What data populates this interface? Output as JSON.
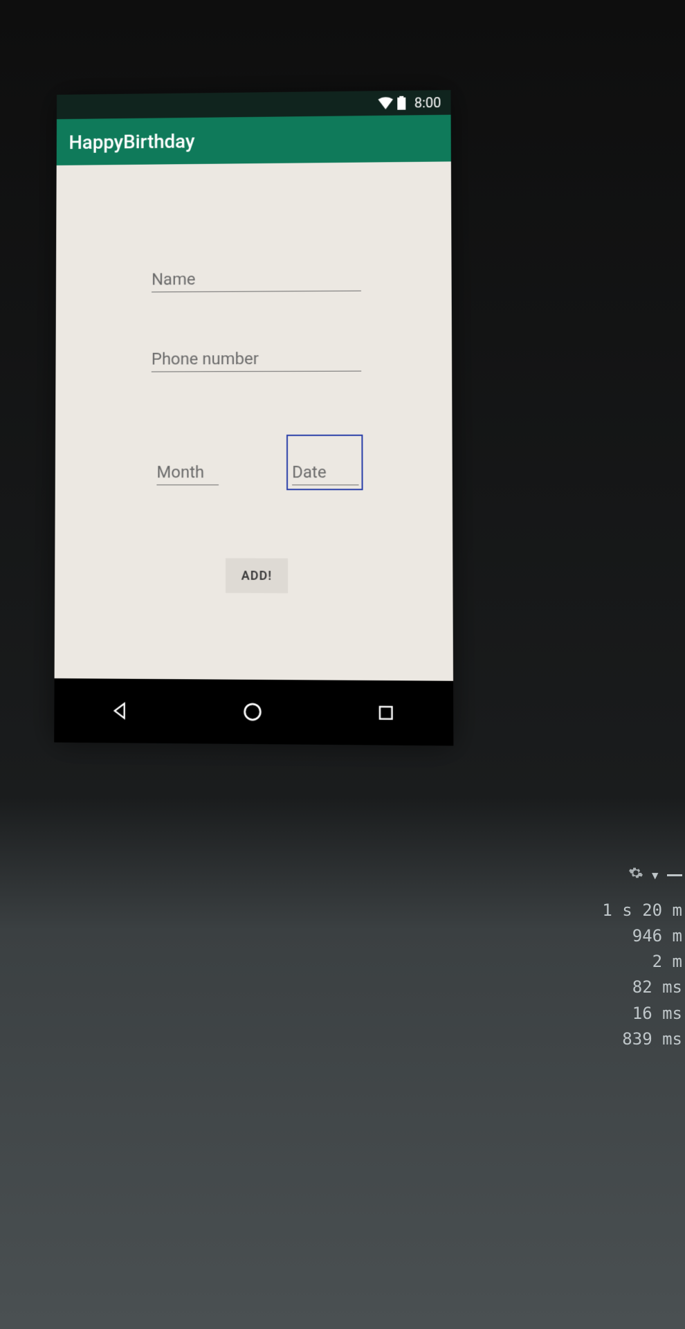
{
  "status": {
    "time": "8:00"
  },
  "appbar": {
    "title": "HappyBirthday"
  },
  "form": {
    "name_hint": "Name",
    "phone_hint": "Phone number",
    "month_hint": "Month",
    "date_hint": "Date",
    "add_label": "ADD!"
  },
  "icons": {
    "wifi": "wifi-icon",
    "battery": "battery-icon",
    "back": "back-icon",
    "home": "home-icon",
    "recents": "recents-icon",
    "gear": "gear-icon"
  },
  "log": {
    "lines": [
      "1 s 20 m",
      "946 m",
      "2 m",
      "82 ms",
      "16 ms",
      "839 ms"
    ]
  }
}
